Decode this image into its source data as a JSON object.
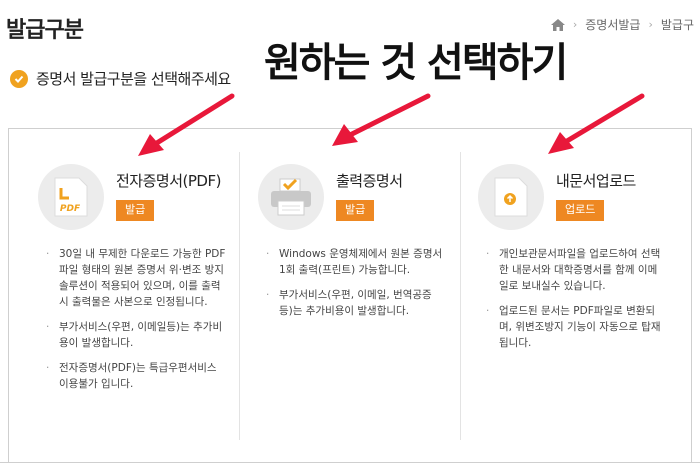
{
  "header": {
    "title": "발급구분",
    "breadcrumb": [
      "증명서발급",
      "발급구"
    ]
  },
  "subtitle": "증명서 발급구분을 선택해주세요",
  "overlay_caption": "원하는 것 선택하기",
  "options": [
    {
      "title": "전자증명서(PDF)",
      "button": "발급",
      "icon": "pdf-file-icon",
      "icon_label": "PDF",
      "bullets": [
        "30일 내 무제한 다운로드 가능한 PDF 파일 형태의 원본 증명서 위·변조 방지 솔루션이 적용되어 있으며, 이를 출력 시 출력물은 사본으로 인정됩니다.",
        "부가서비스(우편, 이메일등)는 추가비용이 발생합니다.",
        "전자증명서(PDF)는 특급우편서비스 이용불가 입니다."
      ]
    },
    {
      "title": "출력증명서",
      "button": "발급",
      "icon": "printer-icon",
      "bullets": [
        "Windows 운영체제에서 원본 증명서 1회 출력(프린트) 가능합니다.",
        "부가서비스(우편, 이메일, 번역공증 등)는 추가비용이 발생합니다."
      ]
    },
    {
      "title": "내문서업로드",
      "button": "업로드",
      "icon": "upload-file-icon",
      "bullets": [
        "개인보관문서파일을 업로드하여 선택한 내문서와 대학증명서를 함께 이메일로 보내실수 있습니다.",
        "업로드된 문서는 PDF파일로 변환되며, 위변조방지 기능이 자동으로 탑재됩니다."
      ]
    }
  ],
  "colors": {
    "accent": "#ee8822",
    "check": "#f0a21f",
    "annotation_arrow": "#e8183a"
  }
}
